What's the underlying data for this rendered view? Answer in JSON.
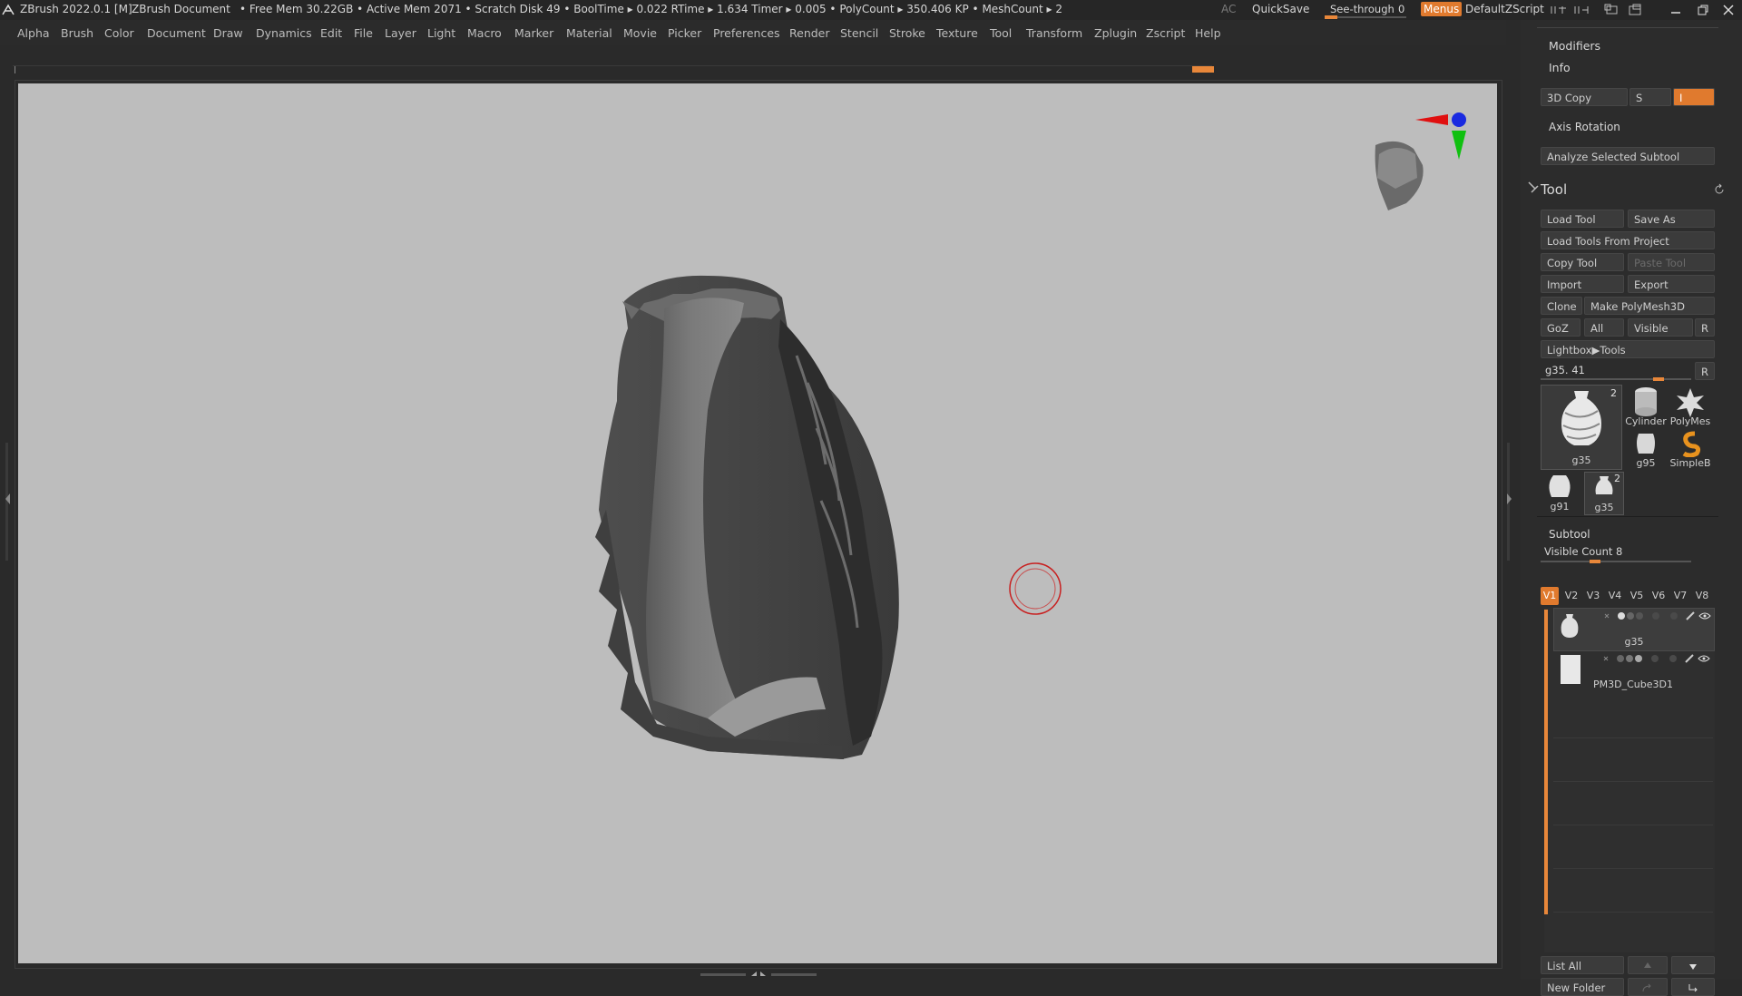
{
  "titlebar": {
    "app_title": "ZBrush 2022.0.1 [M]",
    "document": "ZBrush Document",
    "stats": "• Free Mem 30.22GB • Active Mem 2071 • Scratch Disk 49 •  BoolTime ▸ 0.022 RTime ▸ 1.634 Timer ▸ 0.005 • PolyCount ▸ 350.406 KP  • MeshCount ▸ 2",
    "ac": "AC",
    "quicksave": "QuickSave",
    "see_through_label": "See-through",
    "see_through_value": "0",
    "menus": "Menus",
    "zscript": "DefaultZScript"
  },
  "menubar": {
    "items": [
      "Alpha",
      "Brush",
      "Color",
      "Document",
      "Draw",
      "Dynamics",
      "Edit",
      "File",
      "Layer",
      "Light",
      "Macro",
      "Marker",
      "Material",
      "Movie",
      "Picker",
      "Preferences",
      "Render",
      "Stencil",
      "Stroke",
      "Texture",
      "Tool",
      "Transform",
      "Zplugin",
      "Zscript",
      "Help"
    ]
  },
  "panel_top": {
    "modifiers": "Modifiers",
    "info": "Info",
    "copy3d": "3D Copy",
    "s_label": "S",
    "i_label": "I",
    "axis_rotation": "Axis Rotation",
    "analyze": "Analyze Selected Subtool"
  },
  "tool": {
    "title": "Tool",
    "load_tool": "Load Tool",
    "save_as": "Save As",
    "load_from_project": "Load Tools From Project",
    "copy_tool": "Copy Tool",
    "paste_tool": "Paste Tool",
    "import": "Import",
    "export": "Export",
    "clone": "Clone",
    "make_polymesh": "Make PolyMesh3D",
    "goz": "GoZ",
    "all": "All",
    "visible": "Visible",
    "r": "R",
    "lightbox": "Lightbox▶Tools",
    "current": "g35. 41",
    "thumbs": {
      "main_label": "g35",
      "main_badge": "2",
      "cylinder": "Cylinder",
      "polymesh": "PolyMes",
      "g95": "g95",
      "simpleb": "SimpleB",
      "g91": "g91",
      "g35b": "g35",
      "g35b_badge": "2"
    }
  },
  "subtool": {
    "title": "Subtool",
    "visible_count": "Visible Count 8",
    "tabs": [
      "V1",
      "V2",
      "V3",
      "V4",
      "V5",
      "V6",
      "V7",
      "V8"
    ],
    "items": [
      {
        "name": "g35"
      },
      {
        "name": "PM3D_Cube3D1"
      }
    ],
    "list_all": "List All",
    "new_folder": "New Folder"
  },
  "colors": {
    "accent": "#e07a2e",
    "viewport_bg": "#bdbdbd",
    "panel_bg": "#2c2c2c",
    "gizmo_x": "#e01010",
    "gizmo_y": "#10c010",
    "gizmo_z": "#1020e0"
  }
}
